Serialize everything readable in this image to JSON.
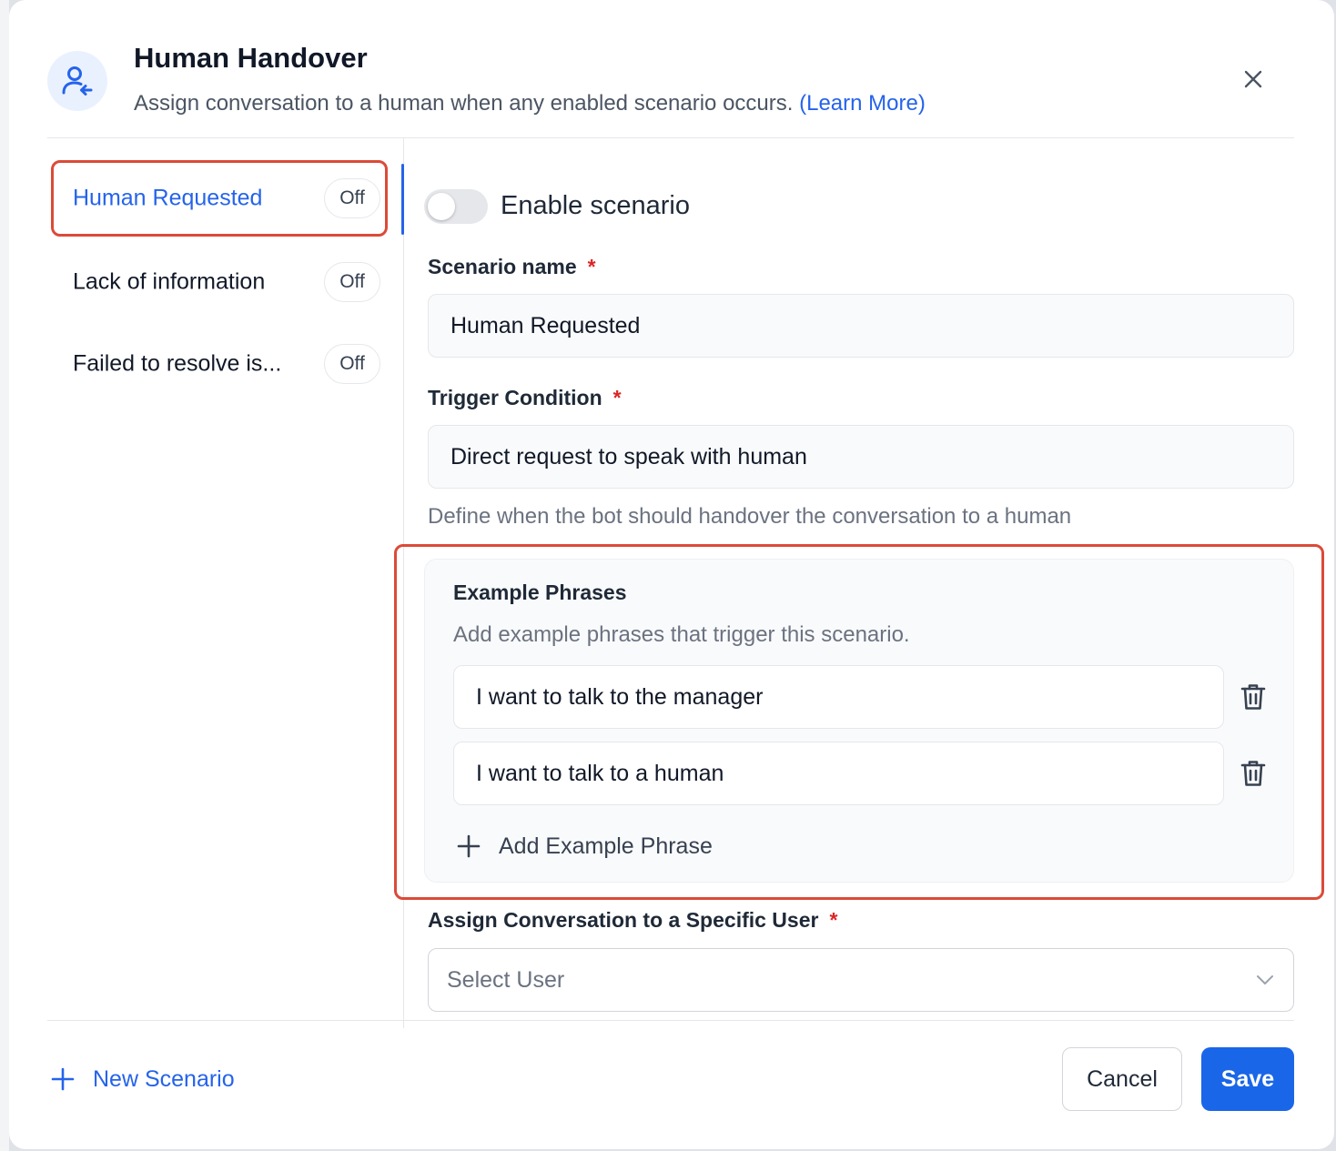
{
  "modal": {
    "title": "Human Handover",
    "subtitle": "Assign conversation to a human when any enabled scenario occurs.",
    "learn_more": "(Learn More)"
  },
  "sidebar": {
    "items": [
      {
        "label": "Human Requested",
        "status": "Off"
      },
      {
        "label": "Lack of information",
        "status": "Off"
      },
      {
        "label": "Failed to resolve is...",
        "status": "Off"
      }
    ],
    "new_scenario": "New Scenario"
  },
  "form": {
    "enable_label": "Enable scenario",
    "enabled": false,
    "scenario_name": {
      "label": "Scenario name",
      "required_mark": "*",
      "value": "Human Requested"
    },
    "trigger_condition": {
      "label": "Trigger Condition",
      "required_mark": "*",
      "value": "Direct request to speak with human",
      "helper": "Define when the bot should handover the conversation to a human"
    },
    "example_phrases": {
      "title": "Example Phrases",
      "description": "Add example phrases that trigger this scenario.",
      "phrases": [
        "I want to talk to the manager",
        "I want to talk to a human"
      ],
      "add_label": "Add Example Phrase"
    },
    "assign_user": {
      "label": "Assign Conversation to a Specific User",
      "required_mark": "*",
      "placeholder": "Select User"
    }
  },
  "footer": {
    "cancel": "Cancel",
    "save": "Save"
  },
  "colors": {
    "accent": "#2563eb",
    "save_button": "#1a66e8",
    "highlight_outline": "#dc4a38",
    "required": "#dc2626"
  },
  "icons": {
    "header": "user-handover-icon",
    "close": "close-icon",
    "delete": "trash-icon",
    "add": "plus-icon",
    "select": "chevron-down-icon"
  }
}
